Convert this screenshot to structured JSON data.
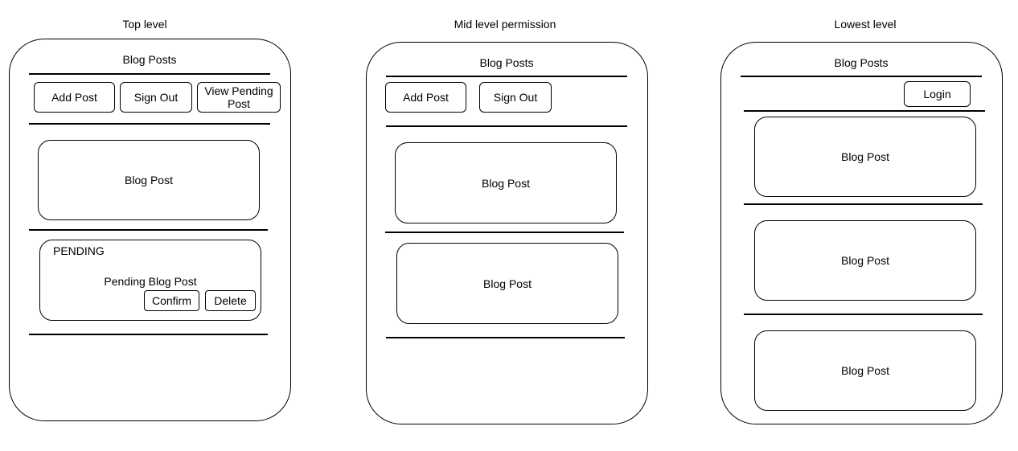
{
  "panels": [
    {
      "caption": "Top level",
      "heading": "Blog Posts",
      "buttons": [
        "Add Post",
        "Sign Out",
        "View Pending Post"
      ],
      "posts": [
        "Blog Post"
      ],
      "pending": {
        "tag": "PENDING",
        "title": "Pending Blog Post",
        "confirm": "Confirm",
        "delete": "Delete"
      }
    },
    {
      "caption": "Mid level permission",
      "heading": "Blog Posts",
      "buttons": [
        "Add Post",
        "Sign Out"
      ],
      "posts": [
        "Blog Post",
        "Blog Post"
      ]
    },
    {
      "caption": "Lowest level",
      "heading": "Blog Posts",
      "buttons": [
        "Login"
      ],
      "posts": [
        "Blog Post",
        "Blog Post",
        "Blog Post"
      ]
    }
  ]
}
